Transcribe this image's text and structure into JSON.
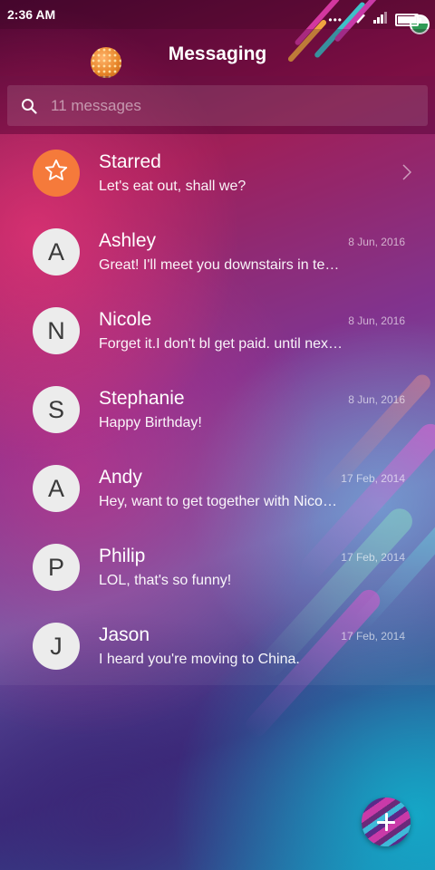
{
  "status_bar": {
    "time": "2:36 AM",
    "signal_dots": "•••",
    "icons": [
      "wifi-icon",
      "signal-icon",
      "battery-icon"
    ],
    "battery_level": 0.9
  },
  "header": {
    "title": "Messaging"
  },
  "search": {
    "placeholder": "11 messages"
  },
  "conversations": [
    {
      "avatar": "",
      "avatar_icon": "star-icon",
      "avatar_color": "#f57a3b",
      "name": "Starred",
      "preview": "Let's eat out, shall we?",
      "date": ""
    },
    {
      "avatar": "A",
      "name": "Ashley",
      "preview": "Great! I'll meet you downstairs in te…",
      "date": "8 Jun, 2016"
    },
    {
      "avatar": "N",
      "name": "Nicole",
      "preview": "Forget it.I don't bl get paid. until nex…",
      "date": "8 Jun, 2016"
    },
    {
      "avatar": "S",
      "name": "Stephanie",
      "preview": "Happy Birthday!",
      "date": "8 Jun, 2016"
    },
    {
      "avatar": "A",
      "name": "Andy",
      "preview": "Hey, want to get together with Nico…",
      "date": "17 Feb, 2014"
    },
    {
      "avatar": "P",
      "name": "Philip",
      "preview": "LOL, that's so funny!",
      "date": "17 Feb, 2014"
    },
    {
      "avatar": "J",
      "name": "Jason",
      "preview": "I heard you're moving to China.",
      "date": "17 Feb, 2014"
    }
  ],
  "fab": {
    "icon": "plus-icon"
  },
  "colors": {
    "starred_accent": "#f57a3b",
    "avatar_bg": "#ececec"
  }
}
